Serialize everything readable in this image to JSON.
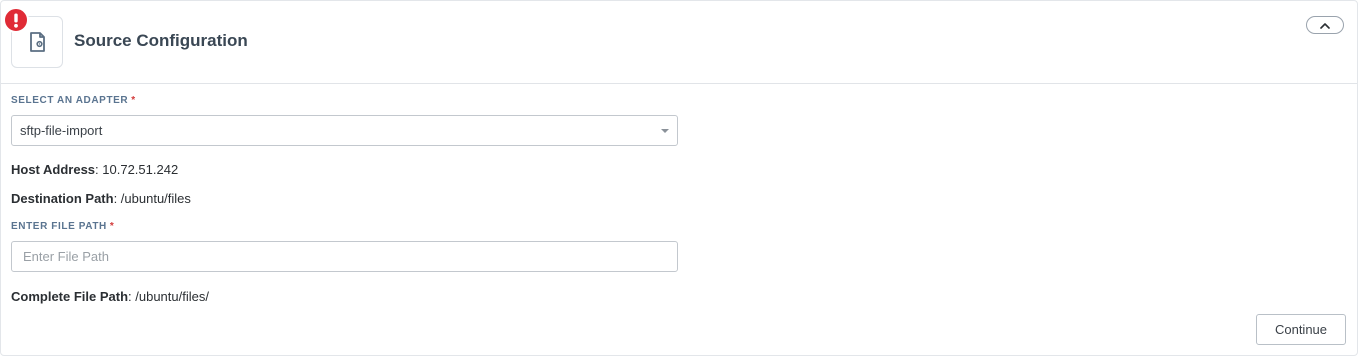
{
  "header": {
    "title": "Source Configuration",
    "icon": "file-settings-icon",
    "alert_icon": "exclamation-icon",
    "alert_color": "#e02b36"
  },
  "adapter": {
    "label": "SELECT AN ADAPTER",
    "required_mark": "*",
    "selected": "sftp-file-import"
  },
  "host": {
    "label": "Host Address",
    "value": ": 10.72.51.242"
  },
  "destination": {
    "label": "Destination Path",
    "value": ": /ubuntu/files"
  },
  "file_path": {
    "label": "ENTER FILE PATH",
    "required_mark": "*",
    "placeholder": "Enter File Path",
    "value": ""
  },
  "complete_path": {
    "label": "Complete File Path",
    "value": ": /ubuntu/files/"
  },
  "actions": {
    "continue_label": "Continue"
  }
}
